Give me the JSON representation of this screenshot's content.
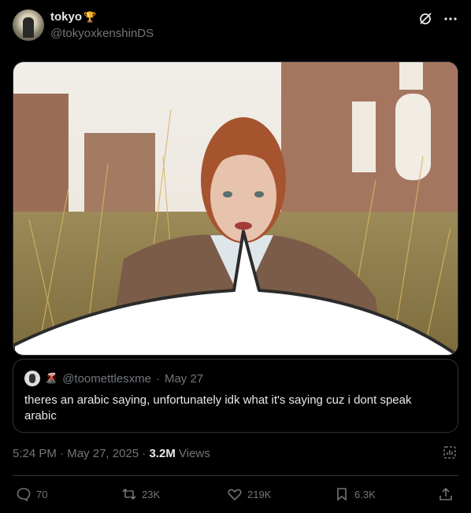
{
  "author": {
    "name": "tokyo",
    "handle": "@tokyoxkenshinDS",
    "badge_icon": "goblet-icon"
  },
  "header_icons": [
    "grok-icon",
    "more-icon"
  ],
  "quote": {
    "handle": "@toomettlesxme",
    "separator": "·",
    "date": "May 27",
    "emoji": "volcano-icon",
    "text": "theres an arabic saying, unfortunately idk what it's saying cuz i dont speak arabic"
  },
  "meta": {
    "time": "5:24 PM",
    "separator": "·",
    "date": "May 27, 2025",
    "separator2": "·",
    "views_count": "3.2M",
    "views_label": "Views"
  },
  "actions": {
    "replies": "70",
    "reposts": "23K",
    "likes": "219K",
    "bookmarks": "6.3K"
  },
  "colors": {
    "background": "#000000",
    "text_primary": "#e7e9ea",
    "text_secondary": "#71767b",
    "border": "#2f3336"
  }
}
